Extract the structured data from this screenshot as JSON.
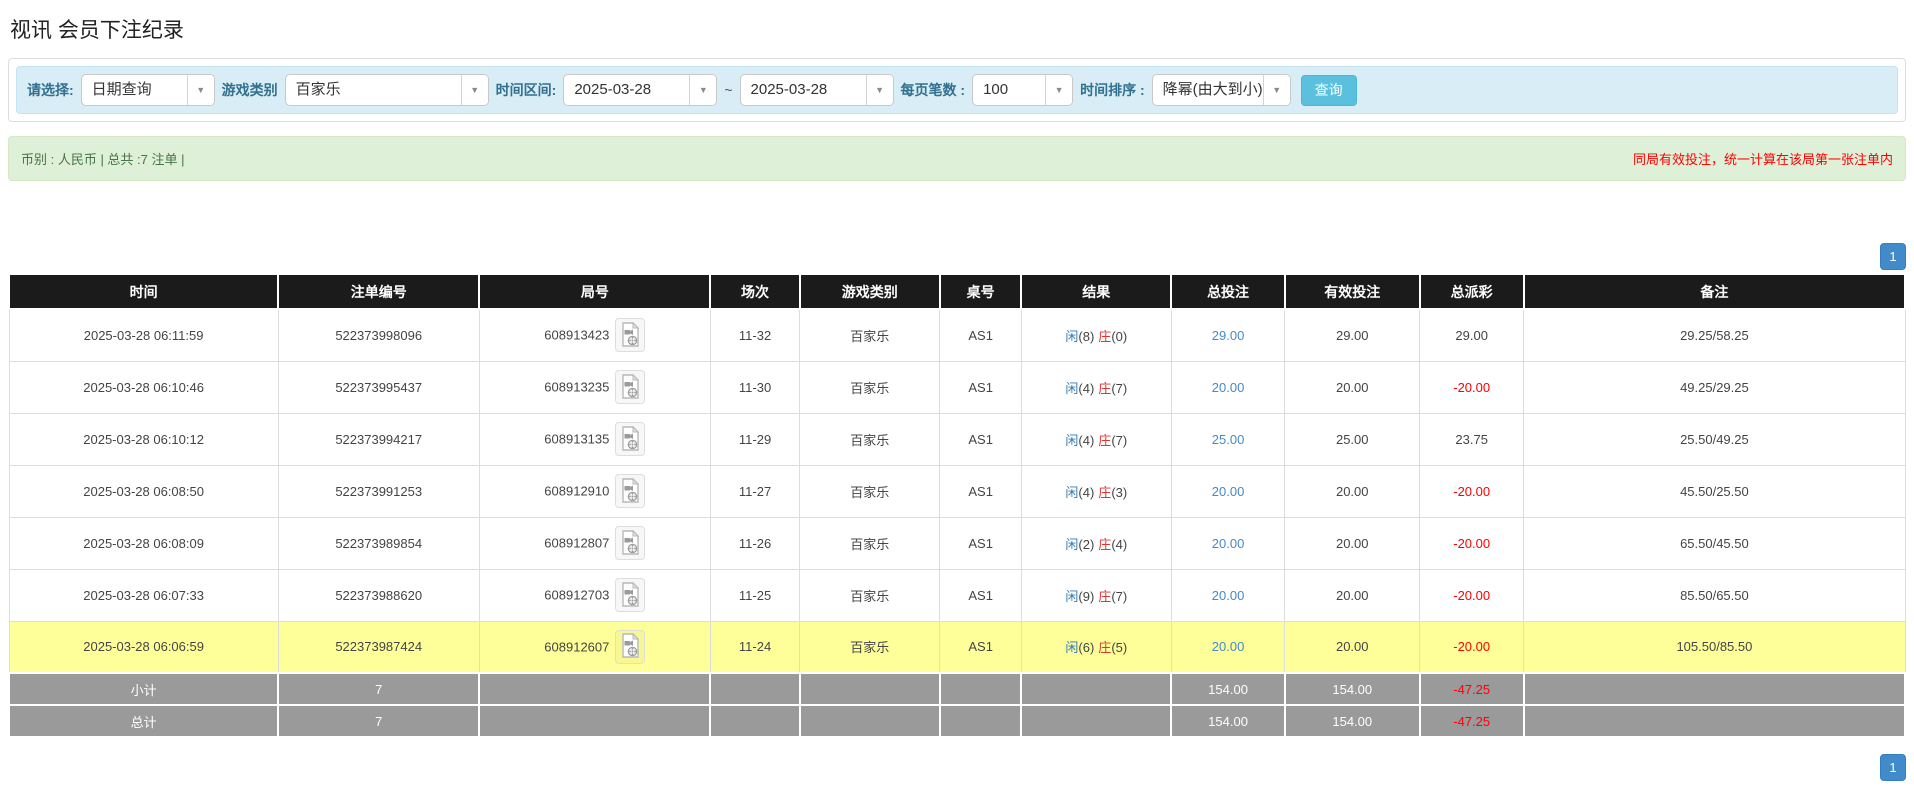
{
  "page_title": "视讯 会员下注纪录",
  "icons": {
    "dropdown_arrow": "▼",
    "video_icon_name": "film-document-icon"
  },
  "filters": {
    "select_label": "请选择:",
    "select_value": "日期查询",
    "game_type_label": "游戏类别",
    "game_type_value": "百家乐",
    "time_range_label": "时间区间:",
    "date_from": "2025-03-28",
    "tilde": "~",
    "date_to": "2025-03-28",
    "page_size_label": "每页笔数 :",
    "page_size_value": "100",
    "sort_label": "时间排序 :",
    "sort_value": "降幂(由大到小)",
    "query_button": "查询"
  },
  "summary": {
    "left_text": "币别 : 人民币 | 总共 :7 注单 |",
    "right_text": "同局有效投注，统一计算在该局第一张注单内"
  },
  "pagination": {
    "page": "1"
  },
  "table": {
    "headers": [
      "时间",
      "注单编号",
      "局号",
      "场次",
      "游戏类别",
      "桌号",
      "结果",
      "总投注",
      "有效投注",
      "总派彩",
      "备注"
    ],
    "rows": [
      {
        "time": "2025-03-28 06:11:59",
        "bet_id": "522373998096",
        "round_id": "608913423",
        "session": "11-32",
        "game": "百家乐",
        "table_no": "AS1",
        "result": {
          "xian_label": "闲",
          "xian_count": "(8)",
          "zhuang_label": "庄",
          "zhuang_count": "(0)"
        },
        "total_bet": "29.00",
        "valid_bet": "29.00",
        "payout": "29.00",
        "remark": "29.25/58.25",
        "highlight": false
      },
      {
        "time": "2025-03-28 06:10:46",
        "bet_id": "522373995437",
        "round_id": "608913235",
        "session": "11-30",
        "game": "百家乐",
        "table_no": "AS1",
        "result": {
          "xian_label": "闲",
          "xian_count": "(4)",
          "zhuang_label": "庄",
          "zhuang_count": "(7)"
        },
        "total_bet": "20.00",
        "valid_bet": "20.00",
        "payout": "-20.00",
        "remark": "49.25/29.25",
        "highlight": false
      },
      {
        "time": "2025-03-28 06:10:12",
        "bet_id": "522373994217",
        "round_id": "608913135",
        "session": "11-29",
        "game": "百家乐",
        "table_no": "AS1",
        "result": {
          "xian_label": "闲",
          "xian_count": "(4)",
          "zhuang_label": "庄",
          "zhuang_count": "(7)"
        },
        "total_bet": "25.00",
        "valid_bet": "25.00",
        "payout": "23.75",
        "remark": "25.50/49.25",
        "highlight": false
      },
      {
        "time": "2025-03-28 06:08:50",
        "bet_id": "522373991253",
        "round_id": "608912910",
        "session": "11-27",
        "game": "百家乐",
        "table_no": "AS1",
        "result": {
          "xian_label": "闲",
          "xian_count": "(4)",
          "zhuang_label": "庄",
          "zhuang_count": "(3)"
        },
        "total_bet": "20.00",
        "valid_bet": "20.00",
        "payout": "-20.00",
        "remark": "45.50/25.50",
        "highlight": false
      },
      {
        "time": "2025-03-28 06:08:09",
        "bet_id": "522373989854",
        "round_id": "608912807",
        "session": "11-26",
        "game": "百家乐",
        "table_no": "AS1",
        "result": {
          "xian_label": "闲",
          "xian_count": "(2)",
          "zhuang_label": "庄",
          "zhuang_count": "(4)"
        },
        "total_bet": "20.00",
        "valid_bet": "20.00",
        "payout": "-20.00",
        "remark": "65.50/45.50",
        "highlight": false
      },
      {
        "time": "2025-03-28 06:07:33",
        "bet_id": "522373988620",
        "round_id": "608912703",
        "session": "11-25",
        "game": "百家乐",
        "table_no": "AS1",
        "result": {
          "xian_label": "闲",
          "xian_count": "(9)",
          "zhuang_label": "庄",
          "zhuang_count": "(7)"
        },
        "total_bet": "20.00",
        "valid_bet": "20.00",
        "payout": "-20.00",
        "remark": "85.50/65.50",
        "highlight": false
      },
      {
        "time": "2025-03-28 06:06:59",
        "bet_id": "522373987424",
        "round_id": "608912607",
        "session": "11-24",
        "game": "百家乐",
        "table_no": "AS1",
        "result": {
          "xian_label": "闲",
          "xian_count": "(6)",
          "zhuang_label": "庄",
          "zhuang_count": "(5)"
        },
        "total_bet": "20.00",
        "valid_bet": "20.00",
        "payout": "-20.00",
        "remark": "105.50/85.50",
        "highlight": true
      }
    ],
    "subtotal": {
      "label": "小计",
      "count": "7",
      "total_bet": "154.00",
      "valid_bet": "154.00",
      "payout": "-47.25"
    },
    "total": {
      "label": "总计",
      "count": "7",
      "total_bet": "154.00",
      "valid_bet": "154.00",
      "payout": "-47.25"
    },
    "colors": {
      "accent_blue": "#428bca",
      "player_blue": "#337ab7",
      "banker_red": "#dd3333",
      "negative_red": "#ff0000",
      "highlight_yellow": "#ffff99",
      "header_black": "#1b1b1b",
      "footer_gray": "#9a9a9a"
    }
  }
}
